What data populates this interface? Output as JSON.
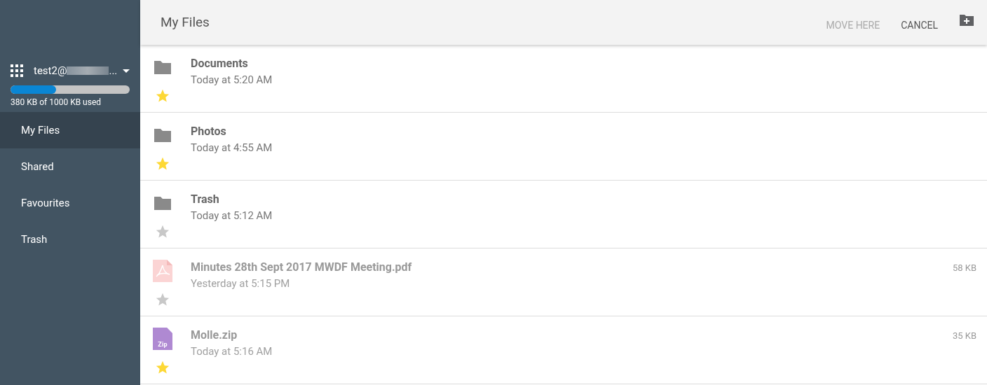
{
  "sidebar": {
    "account": {
      "name": "test2@",
      "ellipsis": "..."
    },
    "storage": {
      "level": 0.38,
      "reading": "380 KB of 1000 KB used"
    },
    "items": [
      {
        "label": "My Files",
        "selected": true
      },
      {
        "label": "Shared",
        "selected": false
      },
      {
        "label": "Favourites",
        "selected": false
      },
      {
        "label": "Trash",
        "selected": false
      }
    ]
  },
  "header": {
    "title": "My Files",
    "actions": [
      {
        "label": "MOVE HERE",
        "disabled": true
      },
      {
        "label": "CANCEL",
        "disabled": false
      }
    ]
  },
  "files": [
    {
      "kind": "folder",
      "name": "Documents",
      "modified": "Today at 5:20 AM",
      "starred": true,
      "disabled": false
    },
    {
      "kind": "folder",
      "name": "Photos",
      "modified": "Today at 4:55 AM",
      "starred": true,
      "disabled": false
    },
    {
      "kind": "folder",
      "name": "Trash",
      "modified": "Today at 5:12 AM",
      "starred": false,
      "disabled": false
    },
    {
      "kind": "pdf",
      "name": "Minutes 28th Sept 2017 MWDF Meeting.pdf",
      "modified": "Yesterday at 5:15 PM",
      "size": "58 KB",
      "starred": false,
      "disabled": true
    },
    {
      "kind": "zip",
      "icon_text": "Zip",
      "name": "Molle.zip",
      "modified": "Today at 5:16 AM",
      "size": "35 KB",
      "starred": true,
      "disabled": true
    }
  ]
}
